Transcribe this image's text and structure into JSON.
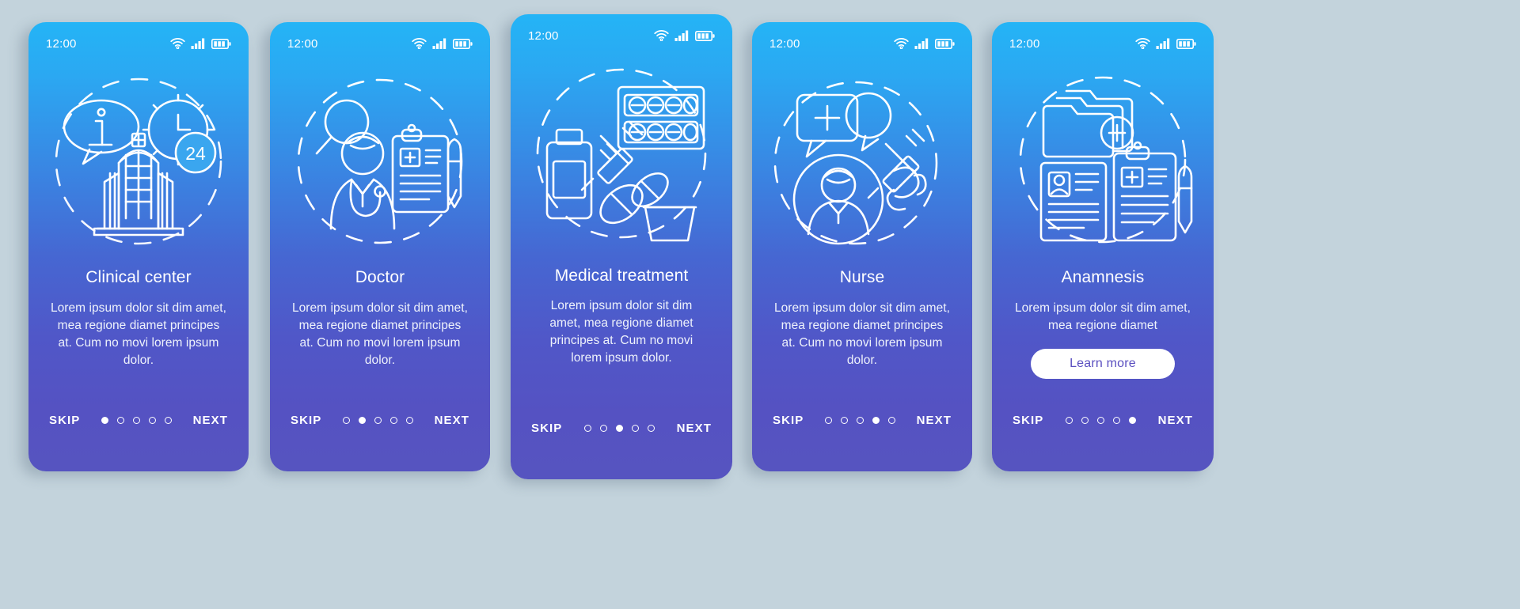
{
  "canvas": {
    "background_color": "#c3d3dc",
    "gradient_top": "#24b4f6",
    "gradient_bottom": "#5654c0",
    "button_text_color": "#5a4fc0"
  },
  "status_bar": {
    "time": "12:00",
    "icons": [
      "wifi-icon",
      "cellular-signal-icon",
      "battery-icon"
    ]
  },
  "nav": {
    "skip_label": "SKIP",
    "next_label": "NEXT",
    "total_dots": 5
  },
  "screens": [
    {
      "id": "clinical-center",
      "title": "Clinical center",
      "description": "Lorem ipsum dolor sit dim amet, mea regione diamet principes at. Cum no movi lorem ipsum dolor.",
      "illustration": "clinical-center-illustration",
      "active_dot": 1,
      "has_learn_more": false,
      "learn_more_label": ""
    },
    {
      "id": "doctor",
      "title": "Doctor",
      "description": "Lorem ipsum dolor sit dim amet, mea regione diamet principes at. Cum no movi lorem ipsum dolor.",
      "illustration": "doctor-illustration",
      "active_dot": 2,
      "has_learn_more": false,
      "learn_more_label": ""
    },
    {
      "id": "medical-treatment",
      "title": "Medical treatment",
      "description": "Lorem ipsum dolor sit dim amet, mea regione diamet principes at. Cum no movi lorem ipsum dolor.",
      "illustration": "medical-treatment-illustration",
      "active_dot": 3,
      "has_learn_more": false,
      "learn_more_label": ""
    },
    {
      "id": "nurse",
      "title": "Nurse",
      "description": "Lorem ipsum dolor sit dim amet, mea regione diamet principes at. Cum no movi lorem ipsum dolor.",
      "illustration": "nurse-illustration",
      "active_dot": 4,
      "has_learn_more": false,
      "learn_more_label": ""
    },
    {
      "id": "anamnesis",
      "title": "Anamnesis",
      "description": "Lorem ipsum dolor sit dim amet, mea regione diamet",
      "illustration": "anamnesis-illustration",
      "active_dot": 5,
      "has_learn_more": true,
      "learn_more_label": "Learn more"
    }
  ]
}
